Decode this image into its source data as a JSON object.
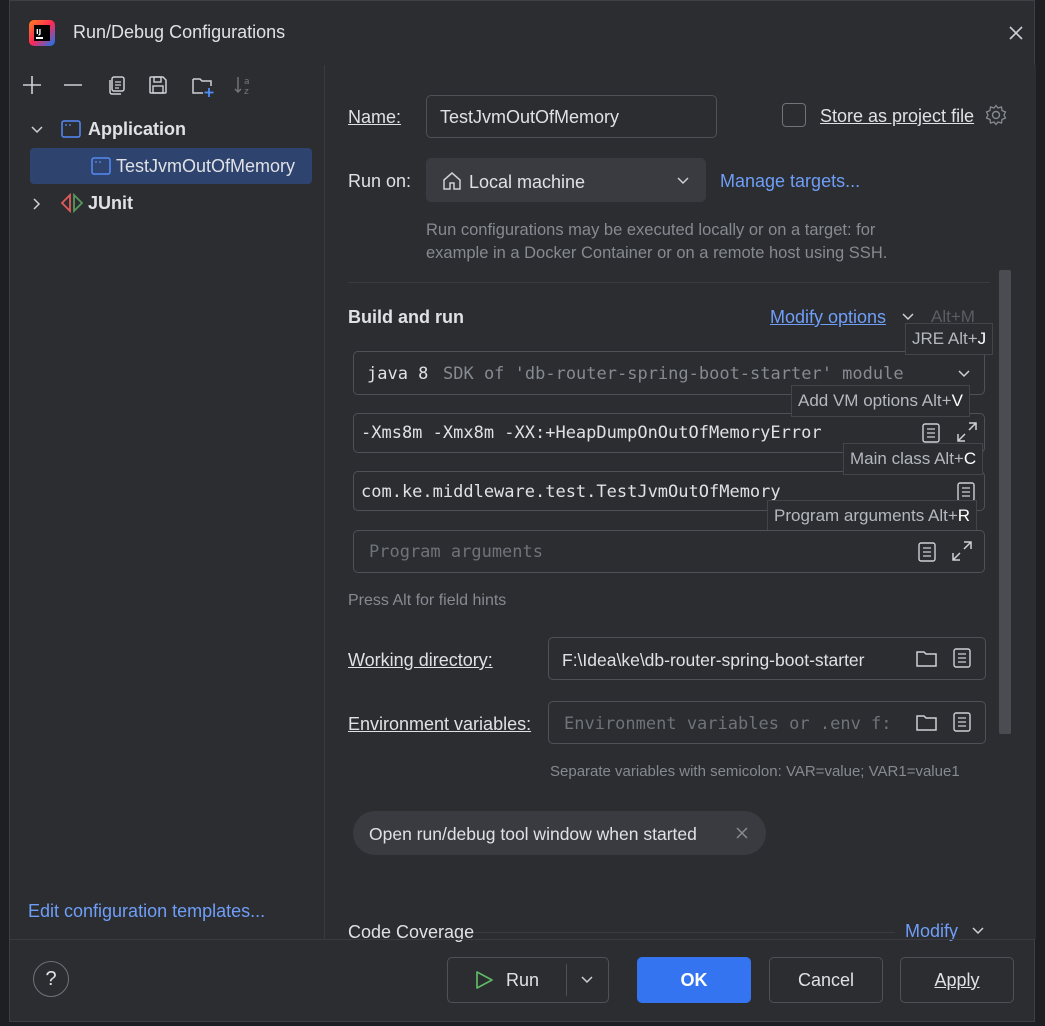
{
  "window": {
    "title": "Run/Debug Configurations"
  },
  "toolbar": {
    "icons": [
      "add-icon",
      "remove-icon",
      "copy-icon",
      "save-icon",
      "folder-add-icon",
      "sort-icon"
    ]
  },
  "tree": {
    "application": "Application",
    "selected_config": "TestJvmOutOfMemory",
    "junit": "JUnit"
  },
  "left_footer": {
    "templates_link": "Edit configuration templates..."
  },
  "form": {
    "name_label": "Name:",
    "name_value": "TestJvmOutOfMemory",
    "store_label": "Store as project file",
    "run_on_label": "Run on:",
    "run_on_value": "Local machine",
    "manage_targets": "Manage targets...",
    "run_on_hint_1": "Run configurations may be executed locally or on a target: for",
    "run_on_hint_2": "example in a Docker Container or on a remote host using SSH.",
    "build_and_run": "Build and run",
    "modify_options": "Modify options",
    "modify_shortcut": "Alt+M",
    "sdk_main": "java 8",
    "sdk_detail": "SDK of 'db-router-spring-boot-starter' module",
    "vm_options": "-Xms8m -Xmx8m -XX:+HeapDumpOnOutOfMemoryError",
    "main_class": "com.ke.middleware.test.TestJvmOutOfMemory",
    "program_args_placeholder": "Program arguments",
    "alt_hint": "Press Alt for field hints",
    "workdir_label": "Working directory:",
    "workdir_value": "F:\\Idea\\ke\\db-router-spring-boot-starter",
    "env_label": "Environment variables:",
    "env_placeholder": "Environment variables or .env f:",
    "env_hint": "Separate variables with semicolon: VAR=value; VAR1=value1",
    "open_tool_window": "Open run/debug tool window when started",
    "code_coverage": "Code Coverage",
    "modify": "Modify"
  },
  "tooltips": {
    "jre": "JRE Alt+",
    "jre_key": "J",
    "vm": "Add VM options Alt+",
    "vm_key": "V",
    "main": "Main class Alt+",
    "main_key": "C",
    "args": "Program arguments Alt+",
    "args_key": "R"
  },
  "buttons": {
    "help": "?",
    "run": "Run",
    "ok": "OK",
    "cancel": "Cancel",
    "apply": "Apply"
  },
  "colors": {
    "accent": "#3574f0",
    "link": "#6f9ef8",
    "selection": "#2e436e",
    "background": "#2b2d30"
  }
}
